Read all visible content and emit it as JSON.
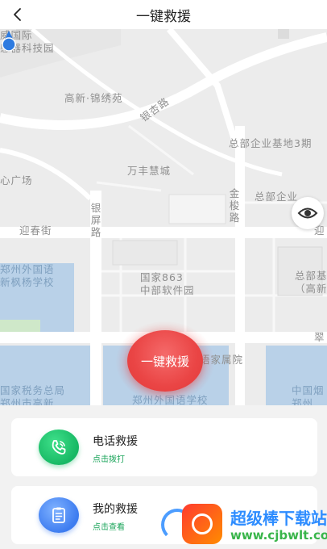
{
  "header": {
    "title": "一键救援",
    "back_icon": "chevron-left-icon"
  },
  "map": {
    "labels": {
      "top_left": "威国际\n感器科技园",
      "gaoxin": "高新·锦绣苑",
      "yinxing_road": "银杏路",
      "hq_base3": "总部企业基地3期",
      "center_plaza": "心广场",
      "wanfeng": "万丰慧城",
      "jinqiao_road": "金梭路",
      "hq_base_b": "总部企业",
      "yingchun": "迎春街",
      "yingping_road": "银屏路",
      "ying_right": "迎",
      "zhengzhou_school": "郑州外国语\n新枫杨学校",
      "national863": "国家863\n中部软件园",
      "hq_right": "总部基\n（高新",
      "cui": "翠",
      "language_college": "语家属院",
      "tax_bureau": "国家税务总局\n郑州市高新",
      "foreign_school2": "郑州外国语学校",
      "china_right": "中国烟\n郑州"
    },
    "locate_icon": "eye-locate-icon",
    "pin_icon": "location-pin-icon"
  },
  "sos": {
    "label": "一键救援"
  },
  "cards": [
    {
      "title": "电话救援",
      "subtitle": "点击拨打",
      "icon": "phone-icon",
      "color": "#17b864"
    },
    {
      "title": "我的救援",
      "subtitle": "点击查看",
      "icon": "clipboard-icon",
      "color": "#3d7cf0"
    }
  ],
  "watermark": {
    "name": "超级棒下载站",
    "url": "www.cjbwlt.com"
  },
  "colors": {
    "sos_red": "#ea4545",
    "accent_green": "#1aa45a",
    "watermark_blue": "#2d8cff",
    "watermark_green": "#39b54a"
  }
}
